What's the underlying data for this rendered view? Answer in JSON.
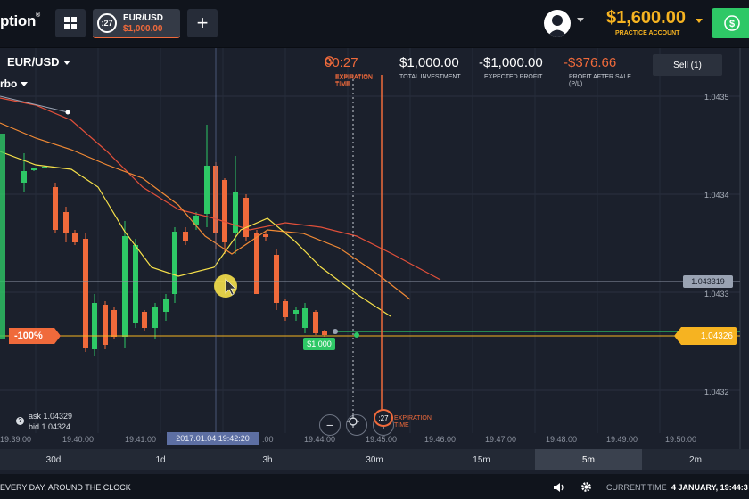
{
  "header": {
    "logo": "ption",
    "logo_mark": "®",
    "asset_tab": {
      "timer": ":27",
      "pair": "EUR/USD",
      "amount": "$1,000.00"
    },
    "add_label": "+",
    "balance": "$1,600.00",
    "account_type": "PRACTICE ACCOUNT"
  },
  "toolbar": {
    "pair": "EUR/USD",
    "option_type": "rbo",
    "expiry": {
      "value": "00:27",
      "label": "EXPIRATION TIME"
    },
    "investment": {
      "value": "$1,000.00",
      "label": "TOTAL INVESTMENT"
    },
    "expected": {
      "value": "-$1,000.00",
      "label": "EXPECTED PROFIT"
    },
    "after_sale": {
      "value": "-$376.66",
      "label": "PROFIT AFTER SALE (P/L)"
    },
    "sell_button": "Sell (1)"
  },
  "chart": {
    "price_labels": [
      "1.0435",
      "1.0434",
      "1.0433",
      "1.0432"
    ],
    "current_price_tag": "1.043319",
    "strike_tag": "1.04326",
    "percent_tag": "-100%",
    "trade_chip": "$1,000",
    "expiry_marker": "EXPIRATION TIME",
    "ask": "ask 1.04329",
    "bid": "bid 1.04324",
    "cursor_time": "2017.01.04 19:42:20",
    "time_ticks": [
      "19:39:00",
      "19:40:00",
      "19:41:00",
      ":00",
      "19:44:00",
      "19:45:00",
      "19:46:00",
      "19:47:00",
      "19:48:00",
      "19:49:00",
      "19:50:00"
    ],
    "zoom_out": "−",
    "zoom_in": "+",
    "expiry_badge": ":27"
  },
  "periods": [
    {
      "label": "30d",
      "active": false
    },
    {
      "label": "1d",
      "active": false
    },
    {
      "label": "3h",
      "active": false
    },
    {
      "label": "30m",
      "active": false
    },
    {
      "label": "15m",
      "active": false
    },
    {
      "label": "5m",
      "active": true
    },
    {
      "label": "2m",
      "active": false
    }
  ],
  "footer": {
    "slogan": "EVERY DAY, AROUND THE CLOCK",
    "time_label": "CURRENT TIME",
    "time_value": "4 JANUARY, 19:44:3"
  },
  "colors": {
    "up": "#2ec866",
    "down": "#f06a3b",
    "accent": "#f6b321"
  }
}
